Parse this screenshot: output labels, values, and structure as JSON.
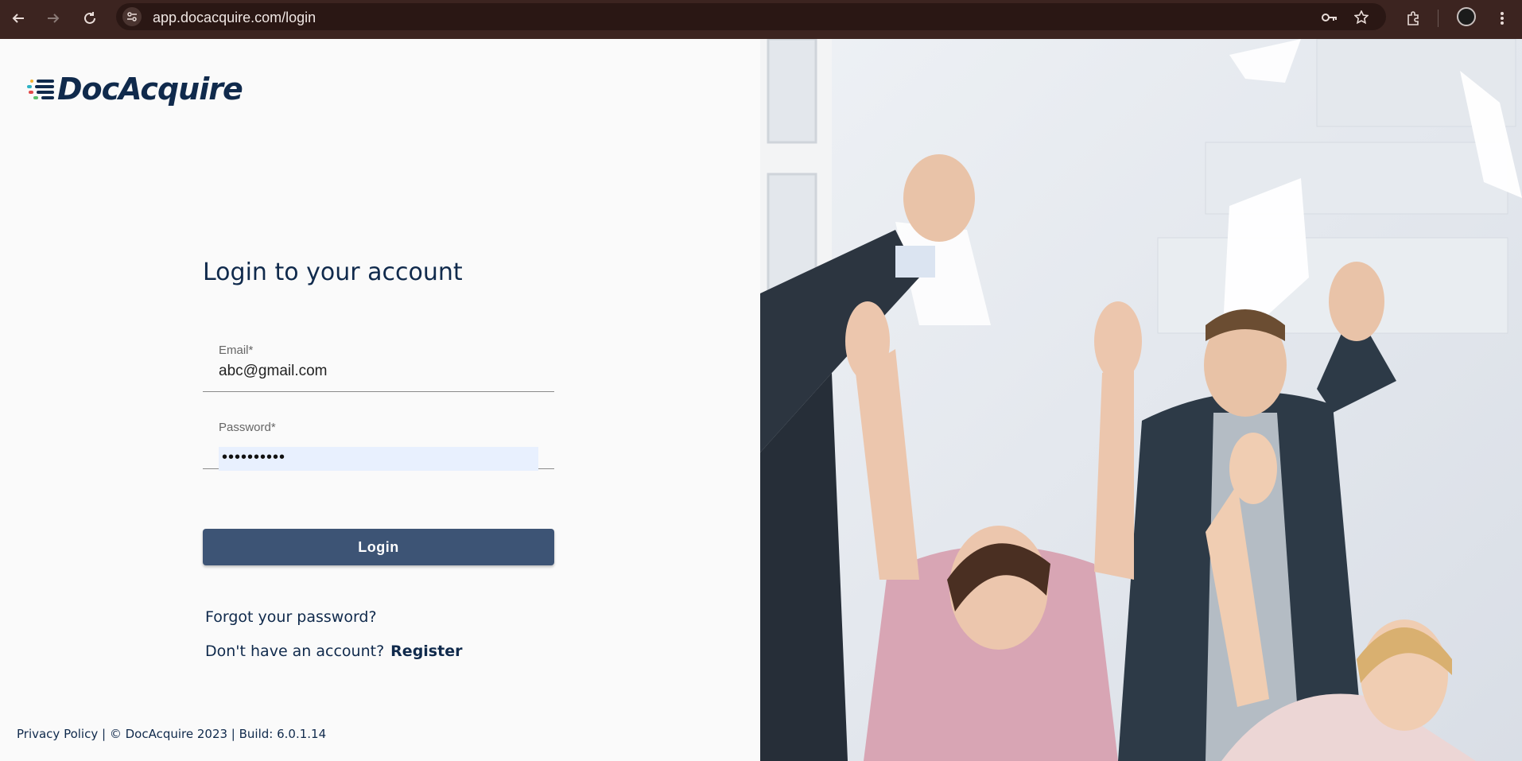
{
  "browser": {
    "url": "app.docacquire.com/login",
    "icons": [
      "back-arrow-icon",
      "forward-arrow-icon",
      "reload-icon",
      "site-info-icon",
      "password-key-icon",
      "bookmark-star-icon",
      "extensions-icon",
      "profile-avatar",
      "more-menu-icon"
    ]
  },
  "brand": {
    "logo_text": "DocAcquire"
  },
  "login": {
    "title": "Login to your account",
    "email_label": "Email*",
    "email_value": "abc@gmail.com",
    "password_label": "Password*",
    "password_value": "••••••••••",
    "login_button": "Login",
    "forgot_link": "Forgot your password?",
    "no_account_text": "Don't have an account?",
    "register_link": "Register"
  },
  "footer": {
    "privacy_link": "Privacy Policy",
    "copyright": "| © DocAcquire 2023 | Build: 6.0.1.14"
  },
  "photo": {
    "description_icon": "people-celebrating-photo"
  },
  "colors": {
    "brand_navy": "#102a4c",
    "button": "#3d5475",
    "chrome": "#3c2420",
    "autofill": "#e8f0fe"
  }
}
